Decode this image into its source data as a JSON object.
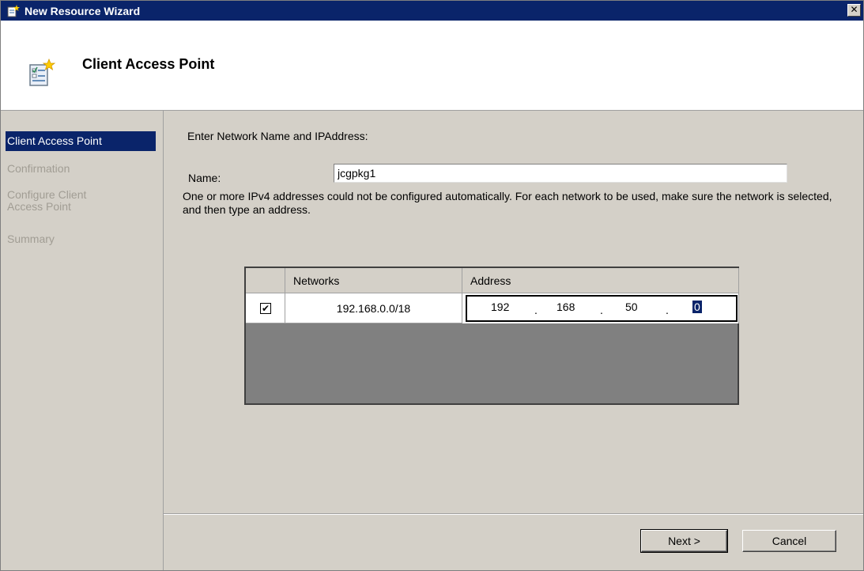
{
  "window": {
    "title": "New Resource Wizard",
    "close_glyph": "✕"
  },
  "header": {
    "title": "Client Access Point"
  },
  "steps": {
    "items": [
      {
        "label": "Client Access Point",
        "active": true
      },
      {
        "label": "Confirmation",
        "active": false
      },
      {
        "label": "Configure Client Access Point",
        "active": false
      },
      {
        "label": "Summary",
        "active": false
      }
    ]
  },
  "form": {
    "instruction": "Enter Network Name and IPAddress:",
    "name_label": "Name:",
    "name_value": "jcgpkg1",
    "message": "One or more IPv4 addresses could not be configured automatically.  For each network to be used, make sure the network is selected, and then type an address."
  },
  "grid": {
    "columns": [
      "",
      "Networks",
      "Address"
    ],
    "rows": [
      {
        "checked": true,
        "network": "192.168.0.0/18",
        "address": {
          "octet1": "192",
          "octet2": "168",
          "octet3": "50",
          "octet4": "0"
        }
      }
    ]
  },
  "buttons": {
    "next": "Next >",
    "cancel": "Cancel"
  },
  "colors": {
    "titlebar": "#0a246a",
    "selection": "#0a246a",
    "face": "#d4d0c8",
    "disabled_text": "#a19d94"
  }
}
